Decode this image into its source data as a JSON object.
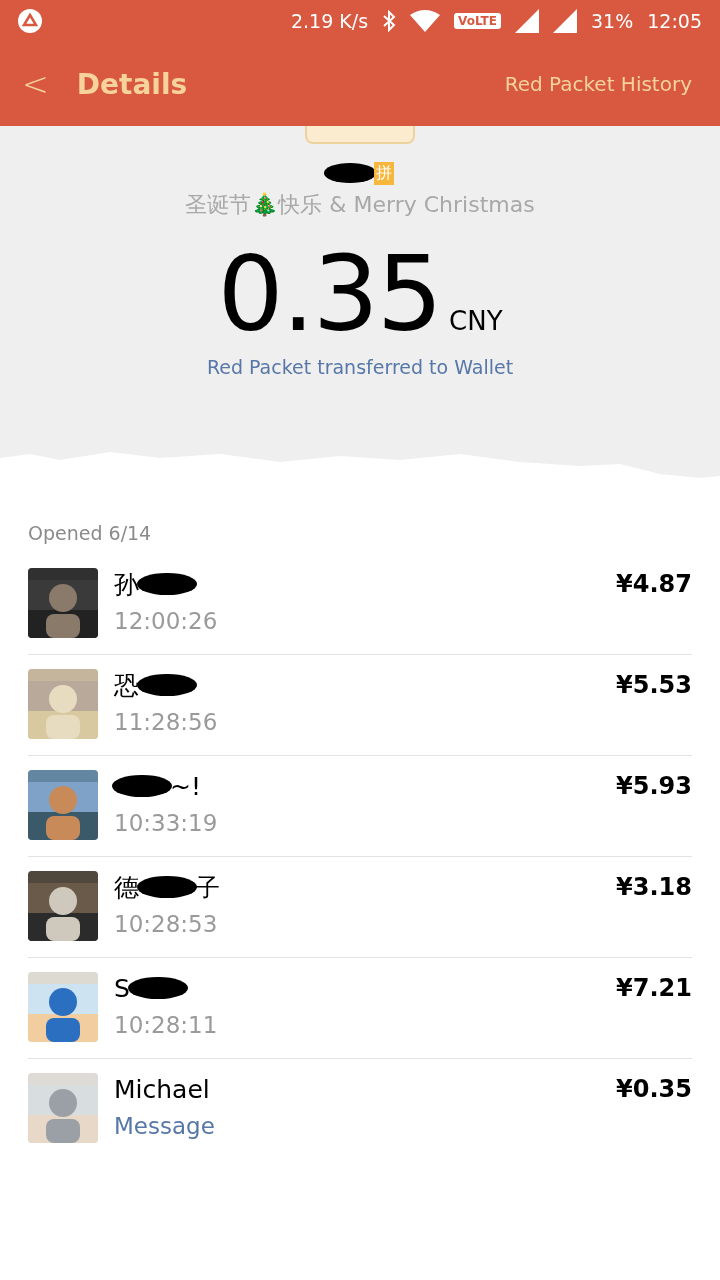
{
  "status_bar": {
    "speed": "2.19 K/s",
    "volte": "VoLTE",
    "battery": "31%",
    "time": "12:05"
  },
  "header": {
    "back": "<",
    "title": "Details",
    "action": "Red Packet History"
  },
  "sender": {
    "name": [
      {
        "kind": "redaction"
      },
      {
        "kind": "badge",
        "text": "拼"
      }
    ],
    "greeting": "圣诞节🎄快乐 & Merry Christmas"
  },
  "amount": {
    "value": "0.35",
    "currency": "CNY",
    "note": "Red Packet transferred to Wallet"
  },
  "opened": "Opened 6/14",
  "recipients": [
    {
      "name": [
        {
          "kind": "text",
          "text": "孙"
        },
        {
          "kind": "redaction"
        }
      ],
      "time": "12:00:26",
      "amount": "¥4.87",
      "kind": "time"
    },
    {
      "name": [
        {
          "kind": "text",
          "text": "恐"
        },
        {
          "kind": "redaction"
        }
      ],
      "time": "11:28:56",
      "amount": "¥5.53",
      "kind": "time"
    },
    {
      "name": [
        {
          "kind": "redaction"
        },
        {
          "kind": "text",
          "text": "~!"
        }
      ],
      "time": "10:33:19",
      "amount": "¥5.93",
      "kind": "time"
    },
    {
      "name": [
        {
          "kind": "text",
          "text": "德"
        },
        {
          "kind": "redaction"
        },
        {
          "kind": "text",
          "text": "子"
        }
      ],
      "time": "10:28:53",
      "amount": "¥3.18",
      "kind": "time"
    },
    {
      "name": [
        {
          "kind": "text",
          "text": "S"
        },
        {
          "kind": "redaction"
        }
      ],
      "time": "10:28:11",
      "amount": "¥7.21",
      "kind": "time"
    },
    {
      "name": [
        {
          "kind": "text",
          "text": "Michael"
        }
      ],
      "time": "Message",
      "amount": "¥0.35",
      "kind": "link"
    }
  ]
}
